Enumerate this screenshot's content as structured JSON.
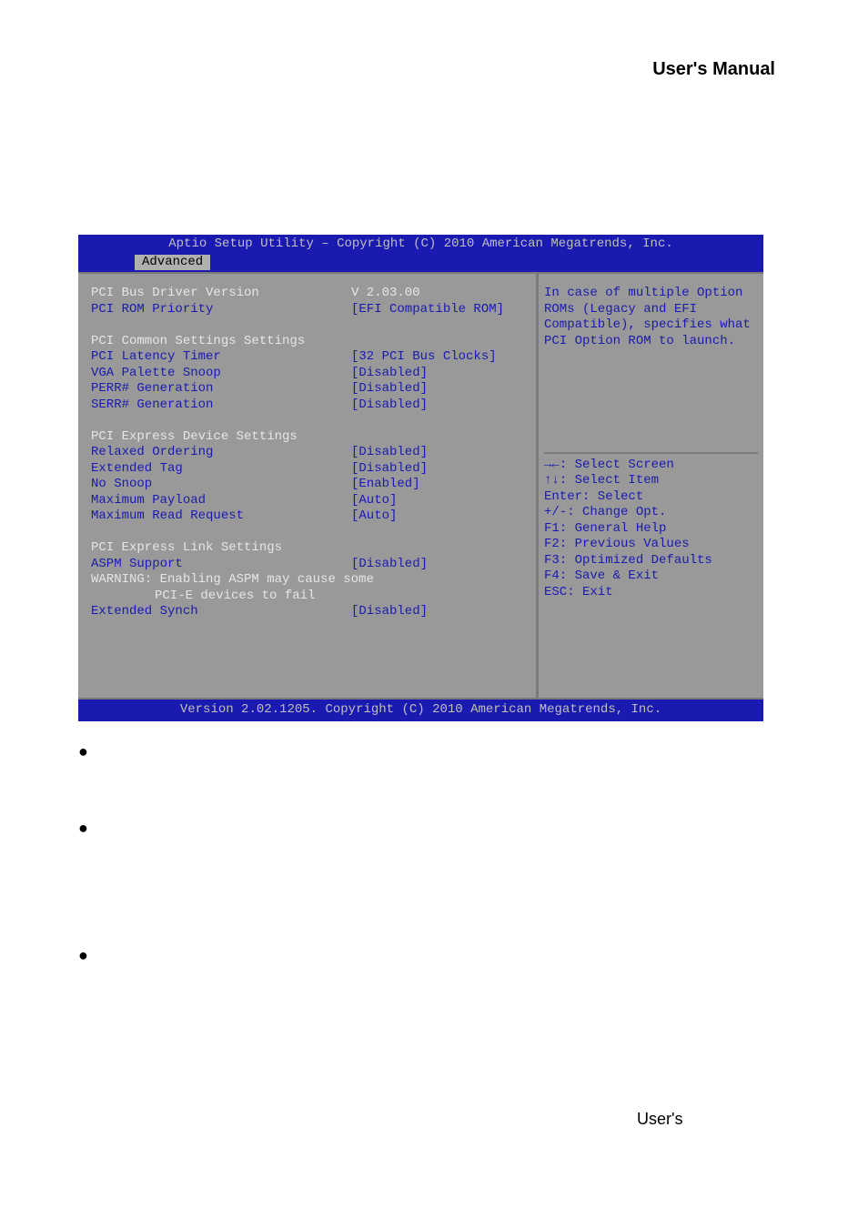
{
  "page_header": "User's  Manual",
  "page_footer": "User's",
  "bios": {
    "title": "Aptio Setup Utility – Copyright (C) 2010 American Megatrends, Inc.",
    "tab": "Advanced",
    "footer": "Version 2.02.1205. Copyright (C) 2010 American Megatrends, Inc.",
    "rows": {
      "r0_label": "PCI Bus Driver Version",
      "r0_value": "V 2.03.00",
      "r1_label": "PCI ROM Priority",
      "r1_value": "[EFI Compatible ROM]",
      "sec1": "PCI Common Settings Settings",
      "r2_label": "PCI Latency Timer",
      "r2_value": "[32 PCI Bus Clocks]",
      "r3_label": "VGA Palette Snoop",
      "r3_value": "[Disabled]",
      "r4_label": "PERR# Generation",
      "r4_value": "[Disabled]",
      "r5_label": "SERR# Generation",
      "r5_value": "[Disabled]",
      "sec2": "PCI Express Device Settings",
      "r6_label": "Relaxed Ordering",
      "r6_value": "[Disabled]",
      "r7_label": "Extended Tag",
      "r7_value": "[Disabled]",
      "r8_label": "No Snoop",
      "r8_value": "[Enabled]",
      "r9_label": "Maximum Payload",
      "r9_value": "[Auto]",
      "r10_label": "Maximum Read Request",
      "r10_value": "[Auto]",
      "sec3": "PCI Express Link Settings",
      "r11_label": "ASPM Support",
      "r11_value": "[Disabled]",
      "warn1": "WARNING: Enabling ASPM may cause some",
      "warn2": "PCI-E devices to fail",
      "r12_label": "Extended Synch",
      "r12_value": "[Disabled]"
    },
    "help": {
      "l1": "In case of multiple Option",
      "l2": "ROMs (Legacy and EFI",
      "l3": "Compatible), specifies what",
      "l4": "PCI Option ROM to launch.",
      "k1": "→←: Select Screen",
      "k2": "↑↓: Select Item",
      "k3": "Enter: Select",
      "k4": "+/-: Change Opt.",
      "k5": "F1: General Help",
      "k6": "F2: Previous Values",
      "k7": "F3: Optimized Defaults",
      "k8": "F4: Save & Exit",
      "k9": "ESC: Exit"
    }
  },
  "bullets": {
    "b1": "●",
    "b2": "●",
    "b3": "●"
  }
}
